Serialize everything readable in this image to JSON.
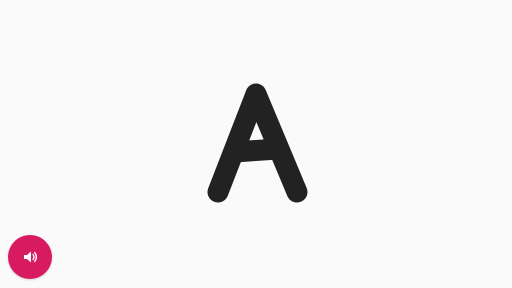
{
  "display": {
    "letter": "A",
    "letter_color": "#222222",
    "background_color": "#fafafa"
  },
  "controls": {
    "speak_button": {
      "icon": "speaker-icon",
      "color": "#d81b60"
    }
  }
}
